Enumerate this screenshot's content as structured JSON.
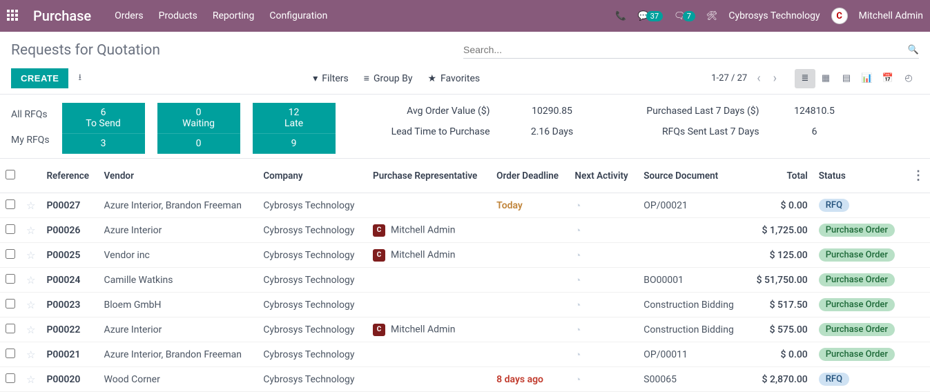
{
  "nav": {
    "brand": "Purchase",
    "menu": [
      "Orders",
      "Products",
      "Reporting",
      "Configuration"
    ],
    "messages_count": "37",
    "chat_count": "7",
    "company": "Cybrosys Technology",
    "user": "Mitchell Admin"
  },
  "page": {
    "title": "Requests for Quotation",
    "search_placeholder": "Search...",
    "create_label": "CREATE",
    "filters_label": "Filters",
    "groupby_label": "Group By",
    "favorites_label": "Favorites",
    "pager": "1-27 / 27"
  },
  "dashboard": {
    "row_labels": [
      "All RFQs",
      "My RFQs"
    ],
    "tiles": [
      {
        "name": "To Send",
        "all": "6",
        "my": "3"
      },
      {
        "name": "Waiting",
        "all": "0",
        "my": "0"
      },
      {
        "name": "Late",
        "all": "12",
        "my": "9"
      }
    ],
    "stats": {
      "avg_label": "Avg Order Value ($)",
      "avg_value": "10290.85",
      "lead_label": "Lead Time to Purchase",
      "lead_value": "2.16  Days",
      "purch_label": "Purchased Last 7 Days ($)",
      "purch_value": "124810.5",
      "sent_label": "RFQs Sent Last 7 Days",
      "sent_value": "6"
    }
  },
  "table": {
    "headers": {
      "reference": "Reference",
      "vendor": "Vendor",
      "company": "Company",
      "rep": "Purchase Representative",
      "deadline": "Order Deadline",
      "activity": "Next Activity",
      "source": "Source Document",
      "total": "Total",
      "status": "Status"
    },
    "rows": [
      {
        "ref": "P00027",
        "vendor": "Azure Interior, Brandon Freeman",
        "company": "Cybrosys Technology",
        "rep": "",
        "deadline": "Today",
        "dclass": "deadline-orange",
        "source": "OP/00021",
        "total": "$ 0.00",
        "status": "RFQ",
        "sclass": "status-rfq"
      },
      {
        "ref": "P00026",
        "vendor": "Azure Interior",
        "company": "Cybrosys Technology",
        "rep": "Mitchell Admin",
        "deadline": "",
        "dclass": "",
        "source": "",
        "total": "$ 1,725.00",
        "status": "Purchase Order",
        "sclass": "status-po"
      },
      {
        "ref": "P00025",
        "vendor": "Vendor inc",
        "company": "Cybrosys Technology",
        "rep": "Mitchell Admin",
        "deadline": "",
        "dclass": "",
        "source": "",
        "total": "$ 125.00",
        "status": "Purchase Order",
        "sclass": "status-po"
      },
      {
        "ref": "P00024",
        "vendor": "Camille Watkins",
        "company": "Cybrosys Technology",
        "rep": "",
        "deadline": "",
        "dclass": "",
        "source": "BO00001",
        "total": "$ 51,750.00",
        "status": "Purchase Order",
        "sclass": "status-po"
      },
      {
        "ref": "P00023",
        "vendor": "Bloem GmbH",
        "company": "Cybrosys Technology",
        "rep": "",
        "deadline": "",
        "dclass": "",
        "source": "Construction Bidding",
        "total": "$ 517.50",
        "status": "Purchase Order",
        "sclass": "status-po"
      },
      {
        "ref": "P00022",
        "vendor": "Azure Interior",
        "company": "Cybrosys Technology",
        "rep": "Mitchell Admin",
        "deadline": "",
        "dclass": "",
        "source": "Construction Bidding",
        "total": "$ 575.00",
        "status": "Purchase Order",
        "sclass": "status-po"
      },
      {
        "ref": "P00021",
        "vendor": "Azure Interior, Brandon Freeman",
        "company": "Cybrosys Technology",
        "rep": "",
        "deadline": "",
        "dclass": "",
        "source": "OP/00011",
        "total": "$ 0.00",
        "status": "Purchase Order",
        "sclass": "status-po"
      },
      {
        "ref": "P00020",
        "vendor": "Wood Corner",
        "company": "Cybrosys Technology",
        "rep": "",
        "deadline": "8 days ago",
        "dclass": "deadline-red",
        "source": "S00065",
        "total": "$ 2,870.00",
        "status": "RFQ",
        "sclass": "status-rfq"
      }
    ]
  }
}
